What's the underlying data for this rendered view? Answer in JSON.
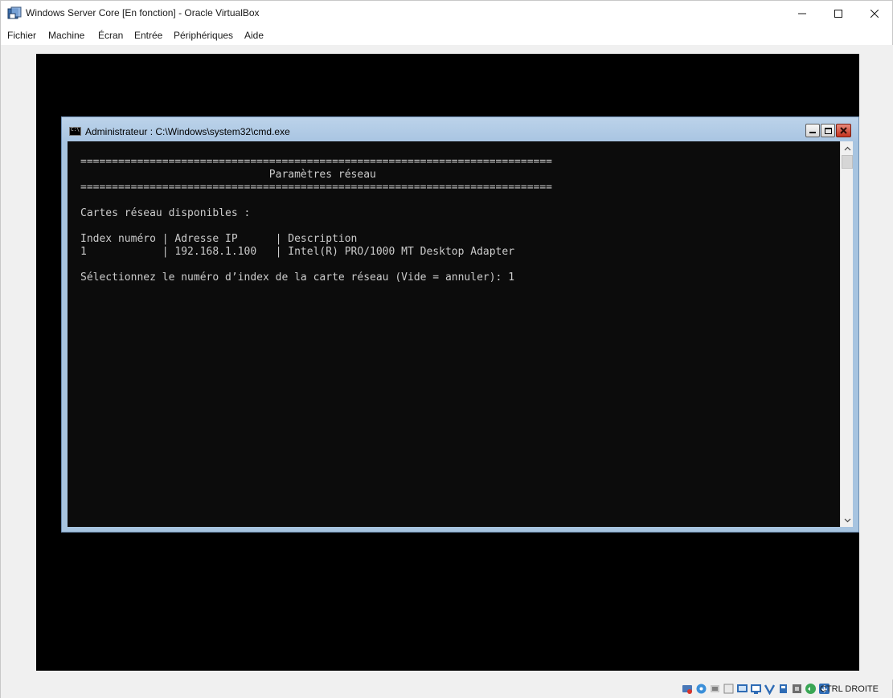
{
  "window": {
    "title": "Windows Server Core [En fonction] - Oracle VirtualBox",
    "icon": "virtualbox-icon"
  },
  "menubar": {
    "items": [
      "Fichier",
      "Machine",
      "Écran",
      "Entrée",
      "Périphériques",
      "Aide"
    ]
  },
  "cmd": {
    "title": "Administrateur : C:\\Windows\\system32\\cmd.exe",
    "lines": [
      "===========================================================================",
      "                              Paramètres réseau",
      "===========================================================================",
      "",
      "Cartes réseau disponibles :",
      "",
      "Index numéro | Adresse IP      | Description",
      "1            | 192.168.1.100   | Intel(R) PRO/1000 MT Desktop Adapter",
      "",
      "Sélectionnez le numéro d’index de la carte réseau (Vide = annuler): 1"
    ]
  },
  "statusbar": {
    "host_key": "CTRL DROITE",
    "icons": [
      "hard-disk-icon",
      "optical-drive-icon",
      "audio-icon",
      "network-icon",
      "usb-icon",
      "shared-folder-icon",
      "display-icon",
      "recording-icon",
      "cpu-icon",
      "mouse-integration-icon",
      "keyboard-icon"
    ]
  }
}
